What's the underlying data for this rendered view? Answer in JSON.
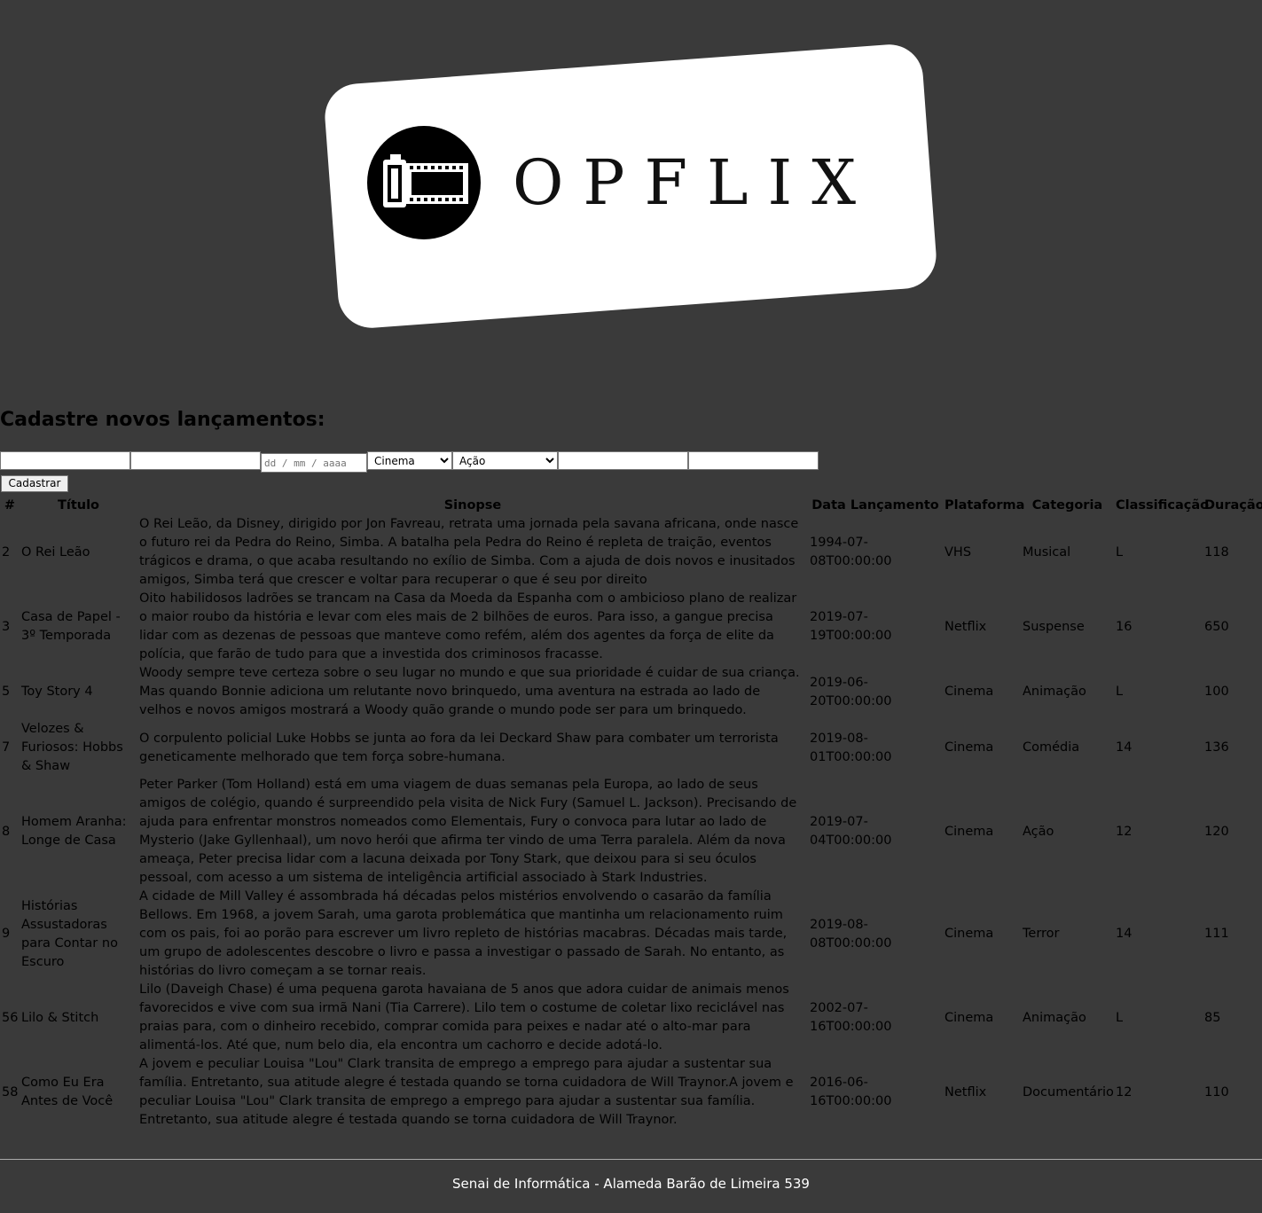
{
  "brand": {
    "name": "OPFLIX",
    "logo_icon": "film-reel-icon"
  },
  "form": {
    "title": "Cadastre novos lançamentos:",
    "fields": {
      "titulo": "",
      "sinopse": "",
      "data_placeholder": "dd / mm / aaaa",
      "plataforma_selected": "Cinema",
      "categoria_selected": "Ação",
      "classificacao": "",
      "duracao": ""
    },
    "submit_label": "Cadastrar"
  },
  "table": {
    "headers": [
      "#",
      "Título",
      "Sinopse",
      "Data Lançamento",
      "Plataforma",
      "Categoria",
      "Classificação",
      "Duração"
    ],
    "rows": [
      {
        "id": "2",
        "titulo": "O Rei Leão",
        "sinopse": "O Rei Leão, da Disney, dirigido por Jon Favreau, retrata uma jornada pela savana africana, onde nasce o futuro rei da Pedra do Reino, Simba. A batalha pela Pedra do Reino é repleta de traição, eventos trágicos e drama, o que acaba resultando no exílio de Simba. Com a ajuda de dois novos e inusitados amigos, Simba terá que crescer e voltar para recuperar o que é seu por direito",
        "data": "1994-07-08T00:00:00",
        "plataforma": "VHS",
        "categoria": "Musical",
        "classificacao": "L",
        "duracao": "118"
      },
      {
        "id": "3",
        "titulo": "Casa de Papel - 3º Temporada",
        "sinopse": "Oito habilidosos ladrões se trancam na Casa da Moeda da Espanha com o ambicioso plano de realizar o maior roubo da história e levar com eles mais de 2 bilhões de euros. Para isso, a gangue precisa lidar com as dezenas de pessoas que manteve como refém, além dos agentes da força de elite da polícia, que farão de tudo para que a investida dos criminosos fracasse.",
        "data": "2019-07-19T00:00:00",
        "plataforma": "Netflix",
        "categoria": "Suspense",
        "classificacao": "16",
        "duracao": "650"
      },
      {
        "id": "5",
        "titulo": "Toy Story 4",
        "sinopse": "Woody sempre teve certeza sobre o seu lugar no mundo e que sua prioridade é cuidar de sua criança. Mas quando Bonnie adiciona um relutante novo brinquedo, uma aventura na estrada ao lado de velhos e novos amigos mostrará a Woody quão grande o mundo pode ser para um brinquedo.",
        "data": "2019-06-20T00:00:00",
        "plataforma": "Cinema",
        "categoria": "Animação",
        "classificacao": "L",
        "duracao": "100"
      },
      {
        "id": "7",
        "titulo": "Velozes & Furiosos: Hobbs & Shaw",
        "sinopse": "O corpulento policial Luke Hobbs se junta ao fora da lei Deckard Shaw para combater um terrorista geneticamente melhorado que tem força sobre-humana.",
        "data": "2019-08-01T00:00:00",
        "plataforma": "Cinema",
        "categoria": "Comédia",
        "classificacao": "14",
        "duracao": "136"
      },
      {
        "id": "8",
        "titulo": "Homem Aranha: Longe de Casa",
        "sinopse": "Peter Parker (Tom Holland) está em uma viagem de duas semanas pela Europa, ao lado de seus amigos de colégio, quando é surpreendido pela visita de Nick Fury (Samuel L. Jackson). Precisando de ajuda para enfrentar monstros nomeados como Elementais, Fury o convoca para lutar ao lado de Mysterio (Jake Gyllenhaal), um novo herói que afirma ter vindo de uma Terra paralela. Além da nova ameaça, Peter precisa lidar com a lacuna deixada por Tony Stark, que deixou para si seu óculos pessoal, com acesso a um sistema de inteligência artificial associado à Stark Industries.",
        "data": "2019-07-04T00:00:00",
        "plataforma": "Cinema",
        "categoria": "Ação",
        "classificacao": "12",
        "duracao": "120"
      },
      {
        "id": "9",
        "titulo": "Histórias Assustadoras para Contar no Escuro",
        "sinopse": "A cidade de Mill Valley é assombrada há décadas pelos mistérios envolvendo o casarão da família Bellows. Em 1968, a jovem Sarah, uma garota problemática que mantinha um relacionamento ruim com os pais, foi ao porão para escrever um livro repleto de histórias macabras. Décadas mais tarde, um grupo de adolescentes descobre o livro e passa a investigar o passado de Sarah. No entanto, as histórias do livro começam a se tornar reais.",
        "data": "2019-08-08T00:00:00",
        "plataforma": "Cinema",
        "categoria": "Terror",
        "classificacao": "14",
        "duracao": "111"
      },
      {
        "id": "56",
        "titulo": "Lilo & Stitch",
        "sinopse": "Lilo (Daveigh Chase) é uma pequena garota havaiana de 5 anos que adora cuidar de animais menos favorecidos e vive com sua irmã Nani (Tia Carrere). Lilo tem o costume de coletar lixo reciclável nas praias para, com o dinheiro recebido, comprar comida para peixes e nadar até o alto-mar para alimentá-los. Até que, num belo dia, ela encontra um cachorro e decide adotá-lo.",
        "data": "2002-07-16T00:00:00",
        "plataforma": "Cinema",
        "categoria": "Animação",
        "classificacao": "L",
        "duracao": "85"
      },
      {
        "id": "58",
        "titulo": "Como Eu Era Antes de Você",
        "sinopse": "A jovem e peculiar Louisa \"Lou\" Clark transita de emprego a emprego para ajudar a sustentar sua família. Entretanto, sua atitude alegre é testada quando se torna cuidadora de Will Traynor.A jovem e peculiar Louisa \"Lou\" Clark transita de emprego a emprego para ajudar a sustentar sua família. Entretanto, sua atitude alegre é testada quando se torna cuidadora de Will Traynor.",
        "data": "2016-06-16T00:00:00",
        "plataforma": "Netflix",
        "categoria": "Documentário",
        "classificacao": "12",
        "duracao": "110"
      }
    ]
  },
  "footer": {
    "text": "Senai de Informática - Alameda Barão de Limeira 539"
  },
  "colors": {
    "background": "#3a3a3a",
    "card": "#ffffff",
    "footer_text": "#ffffff"
  }
}
